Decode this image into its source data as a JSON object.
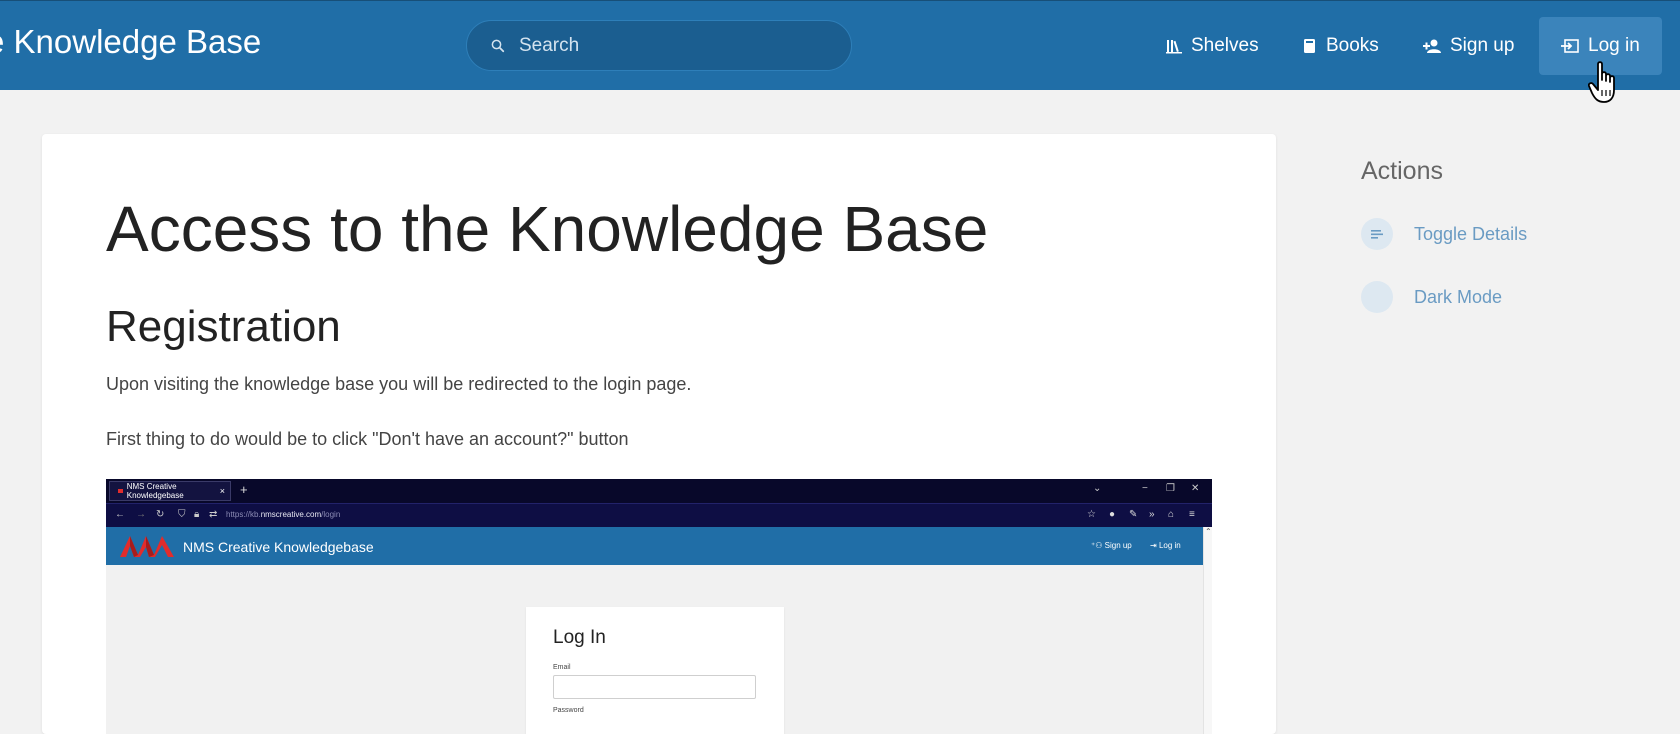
{
  "header": {
    "brand": "e Knowledge Base",
    "search_placeholder": "Search",
    "nav": {
      "shelves": "Shelves",
      "books": "Books",
      "signup": "Sign up",
      "login": "Log in"
    }
  },
  "page": {
    "title": "Access to the Knowledge Base",
    "section": "Registration",
    "paragraph_1": "Upon visiting the knowledge base you will be redirected to the login page.",
    "paragraph_2": "First thing to do would be to click \"Don't have an account?\" button"
  },
  "embedded_screenshot": {
    "tab_title": "NMS Creative Knowledgebase",
    "tab_close": "×",
    "new_tab": "+",
    "url_prefix": "https://kb.",
    "url_host": "nmscreative.com",
    "url_path": "/login",
    "site_title": "NMS Creative Knowledgebase",
    "nav_signup": "Sign up",
    "nav_login": "Log in",
    "login_title": "Log In",
    "email_label": "Email",
    "password_label": "Password"
  },
  "sidebar": {
    "title": "Actions",
    "items": [
      {
        "label": "Toggle Details",
        "icon": "details-icon"
      },
      {
        "label": "Dark Mode",
        "icon": "moon-icon"
      }
    ]
  },
  "colors": {
    "header": "#206ea7",
    "accent_link": "#6a9bc3",
    "background": "#f2f2f2"
  }
}
